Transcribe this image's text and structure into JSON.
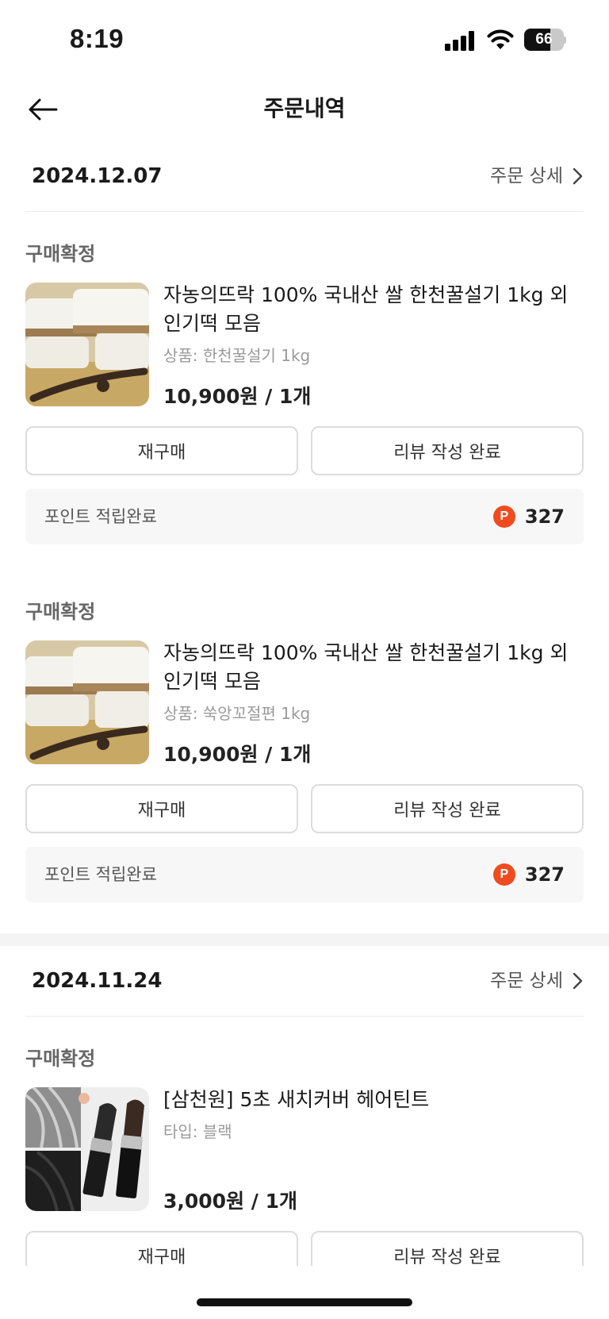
{
  "status_bar": {
    "time": "8:19",
    "battery_percent": "66",
    "battery_level": 0.66
  },
  "header": {
    "title": "주문내역",
    "back_icon": "arrow-left-icon"
  },
  "orders": [
    {
      "date": "2024.12.07",
      "detail_link": "주문 상세",
      "items": [
        {
          "status": "구매확정",
          "name": "자농의뜨락 100% 국내산 쌀 한천꿀설기 1kg 외 인기떡 모음",
          "option": "상품: 한천꿀설기 1kg",
          "price": "10,900원 / 1개",
          "rebuy_label": "재구매",
          "review_label": "리뷰 작성 완료",
          "point_label": "포인트 적립완료",
          "point_icon": "P",
          "point_value": "327"
        },
        {
          "status": "구매확정",
          "name": "자농의뜨락 100% 국내산 쌀 한천꿀설기 1kg 외 인기떡 모음",
          "option": "상품: 쑥앙꼬절편 1kg",
          "price": "10,900원 / 1개",
          "rebuy_label": "재구매",
          "review_label": "리뷰 작성 완료",
          "point_label": "포인트 적립완료",
          "point_icon": "P",
          "point_value": "327"
        }
      ]
    },
    {
      "date": "2024.11.24",
      "detail_link": "주문 상세",
      "items": [
        {
          "status": "구매확정",
          "name": "[삼천원] 5초 새치커버 헤어틴트",
          "option": "타입: 블랙",
          "price": "3,000원 / 1개",
          "rebuy_label": "재구매",
          "review_label": "리뷰 작성 완료"
        }
      ]
    }
  ],
  "colors": {
    "point_icon": "#f04b1f",
    "border": "#dcdcdc",
    "point_bg": "#f7f7f7"
  }
}
